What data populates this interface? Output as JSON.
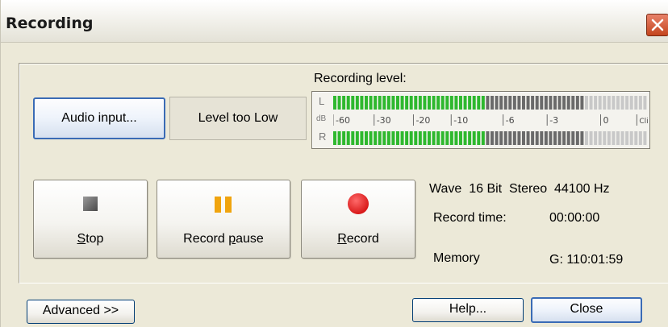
{
  "window": {
    "title": "Recording"
  },
  "audio_input_label": "Audio input...",
  "level_status": "Level too Low",
  "recording_level_label": "Recording level:",
  "meter": {
    "left_label": "L",
    "right_label": "R",
    "db_label": "dB",
    "scale_ticks": [
      "-60",
      "-30",
      "-20",
      "-10",
      "-6",
      "-3",
      "0",
      "Clip"
    ],
    "left_level_fraction": 0.48,
    "right_level_fraction": 0.48,
    "colors": {
      "active": "#2eb82e",
      "inactive": "#6a6a6a",
      "peak": "#c8c8c8"
    }
  },
  "transport": {
    "stop_prefix": "",
    "stop_underlined": "S",
    "stop_rest": "top",
    "pause_prefix": "Record ",
    "pause_underlined": "p",
    "pause_rest": "ause",
    "record_prefix": "",
    "record_underlined": "R",
    "record_rest": "ecord"
  },
  "format_line": "Wave  16 Bit  Stereo  44100 Hz",
  "record_time_label": "Record time:",
  "record_time_value": "00:00:00",
  "memory_label": "Memory",
  "memory_value": "G: 110:01:59",
  "footer": {
    "advanced_label": "Advanced >>",
    "help_label": "Help...",
    "close_label": "Close"
  }
}
